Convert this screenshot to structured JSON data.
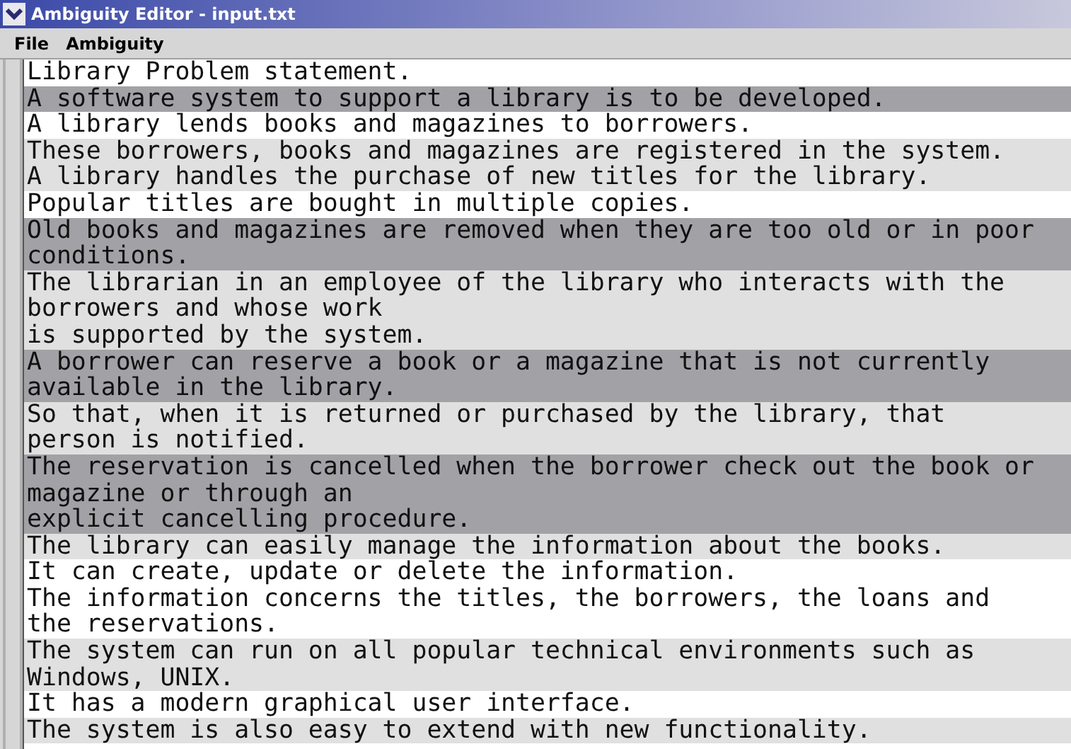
{
  "window": {
    "title": "Ambiguity Editor - input.txt"
  },
  "menu": [
    "File",
    "Ambiguity"
  ],
  "sentences": [
    {
      "color": "#ffffff",
      "lines": [
        "Library Problem statement."
      ]
    },
    {
      "color": "#a2a2a6",
      "lines": [
        "A software system to support a library is to be developed."
      ]
    },
    {
      "color": "#ffffff",
      "lines": [
        "A library lends books and magazines to borrowers."
      ]
    },
    {
      "color": "#e0e0e0",
      "lines": [
        "These borrowers, books and magazines are registered in the system."
      ]
    },
    {
      "color": "#e0e0e0",
      "lines": [
        "A library handles the purchase of new titles for the library."
      ]
    },
    {
      "color": "#ffffff",
      "lines": [
        "Popular titles are bought in multiple copies."
      ]
    },
    {
      "color": "#a2a2a6",
      "lines": [
        "Old books and magazines are removed when they are too old or in poor",
        "conditions."
      ]
    },
    {
      "color": "#e0e0e0",
      "lines": [
        "The librarian in an employee of the library who interacts with the",
        "borrowers and whose work",
        "is supported by the system."
      ]
    },
    {
      "color": "#a2a2a6",
      "lines": [
        "A borrower can reserve a book or a magazine that is not currently",
        "available in the library."
      ]
    },
    {
      "color": "#e0e0e0",
      "lines": [
        "So that, when it is returned or purchased by the library, that",
        "person is notified."
      ]
    },
    {
      "color": "#a2a2a6",
      "lines": [
        "The reservation is cancelled when the borrower check out the book or",
        "magazine or through an",
        "explicit cancelling procedure."
      ]
    },
    {
      "color": "#e0e0e0",
      "lines": [
        "The library can easily manage the information about the books."
      ]
    },
    {
      "color": "#ffffff",
      "lines": [
        "It can create, update or delete the information."
      ]
    },
    {
      "color": "#ffffff",
      "lines": [
        "The information concerns the titles, the borrowers, the loans and",
        "the reservations."
      ]
    },
    {
      "color": "#e0e0e0",
      "lines": [
        "The system can run on all popular technical environments such as",
        "Windows, UNIX."
      ]
    },
    {
      "color": "#ffffff",
      "lines": [
        "It has a modern graphical user interface."
      ]
    },
    {
      "color": "#e0e0e0",
      "lines": [
        "The system is also easy to extend with new functionality."
      ]
    }
  ]
}
